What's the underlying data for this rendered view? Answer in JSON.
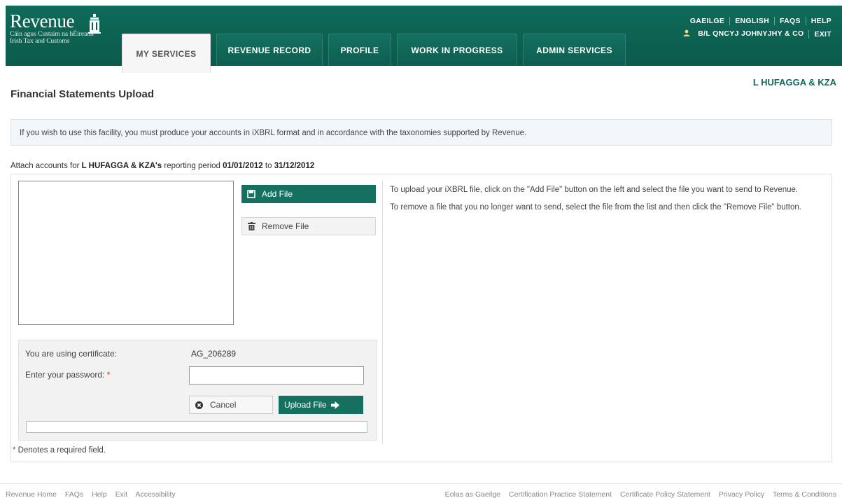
{
  "header": {
    "logo_text": "Revenue",
    "logo_sub1": "Cáin agus Custaim na hÉireann",
    "logo_sub2": "Irish Tax and Customs",
    "tabs": [
      {
        "label": "MY SERVICES",
        "active": true
      },
      {
        "label": "REVENUE RECORD",
        "active": false
      },
      {
        "label": "PROFILE",
        "active": false
      },
      {
        "label": "WORK IN PROGRESS",
        "active": false
      },
      {
        "label": "ADMIN SERVICES",
        "active": false
      }
    ],
    "toplinks": [
      "GAEILGE",
      "ENGLISH",
      "FAQS",
      "HELP"
    ],
    "user_name": "B/L QNCYJ JOHNYJHY & CO",
    "exit_label": "EXIT"
  },
  "client_name": "L HUFAGGA & KZA",
  "page_title": "Financial Statements Upload",
  "info_text": "If you wish to use this facility, you must produce your accounts in iXBRL format and in accordance with the taxonomies supported by Revenue.",
  "attach": {
    "prefix": "Attach accounts for ",
    "client": "L HUFAGGA & KZA's",
    "middle": " reporting period ",
    "from": "01/01/2012",
    "to_word": " to ",
    "to": "31/12/2012"
  },
  "buttons": {
    "add_file": "Add File",
    "remove_file": "Remove File",
    "cancel": "Cancel",
    "upload_file": "Upload File"
  },
  "help": {
    "p1": "To upload your iXBRL file, click on the \"Add File\" button on the left and select the file you want to send to Revenue.",
    "p2": "To remove a file that you no longer want to send, select the file from the list and then click the \"Remove File\" button."
  },
  "certificate": {
    "label": "You are using certificate:",
    "value": "AG_206289",
    "password_label": "Enter your password:",
    "password_value": "",
    "required_marker": "*"
  },
  "required_note": {
    "marker": "*",
    "text": " Denotes a required field."
  },
  "footer": {
    "left_links": [
      "Revenue Home",
      "FAQs",
      "Help",
      "Exit",
      "Accessibility"
    ],
    "right_links": [
      "Eolas as Gaeilge",
      "Certification Practice Statement",
      "Certificate Policy Statement",
      "Privacy Policy",
      "Terms & Conditions"
    ]
  },
  "colors": {
    "brand_green": "#0c5e4f",
    "button_green": "#157060",
    "required_red": "#c0392b"
  },
  "icons": [
    "harp-icon",
    "user-icon",
    "add-file-icon",
    "trash-icon",
    "cancel-icon",
    "arrow-right-icon"
  ]
}
